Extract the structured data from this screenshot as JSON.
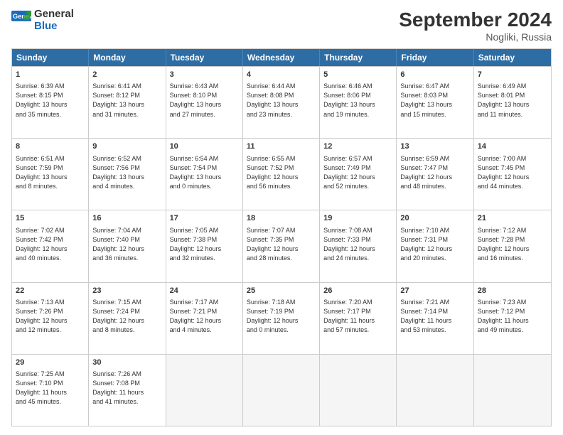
{
  "header": {
    "logo_general": "General",
    "logo_blue": "Blue",
    "title": "September 2024",
    "subtitle": "Nogliki, Russia"
  },
  "days_of_week": [
    "Sunday",
    "Monday",
    "Tuesday",
    "Wednesday",
    "Thursday",
    "Friday",
    "Saturday"
  ],
  "weeks": [
    [
      {
        "day": "1",
        "info": "Sunrise: 6:39 AM\nSunset: 8:15 PM\nDaylight: 13 hours\nand 35 minutes."
      },
      {
        "day": "2",
        "info": "Sunrise: 6:41 AM\nSunset: 8:12 PM\nDaylight: 13 hours\nand 31 minutes."
      },
      {
        "day": "3",
        "info": "Sunrise: 6:43 AM\nSunset: 8:10 PM\nDaylight: 13 hours\nand 27 minutes."
      },
      {
        "day": "4",
        "info": "Sunrise: 6:44 AM\nSunset: 8:08 PM\nDaylight: 13 hours\nand 23 minutes."
      },
      {
        "day": "5",
        "info": "Sunrise: 6:46 AM\nSunset: 8:06 PM\nDaylight: 13 hours\nand 19 minutes."
      },
      {
        "day": "6",
        "info": "Sunrise: 6:47 AM\nSunset: 8:03 PM\nDaylight: 13 hours\nand 15 minutes."
      },
      {
        "day": "7",
        "info": "Sunrise: 6:49 AM\nSunset: 8:01 PM\nDaylight: 13 hours\nand 11 minutes."
      }
    ],
    [
      {
        "day": "8",
        "info": "Sunrise: 6:51 AM\nSunset: 7:59 PM\nDaylight: 13 hours\nand 8 minutes."
      },
      {
        "day": "9",
        "info": "Sunrise: 6:52 AM\nSunset: 7:56 PM\nDaylight: 13 hours\nand 4 minutes."
      },
      {
        "day": "10",
        "info": "Sunrise: 6:54 AM\nSunset: 7:54 PM\nDaylight: 13 hours\nand 0 minutes."
      },
      {
        "day": "11",
        "info": "Sunrise: 6:55 AM\nSunset: 7:52 PM\nDaylight: 12 hours\nand 56 minutes."
      },
      {
        "day": "12",
        "info": "Sunrise: 6:57 AM\nSunset: 7:49 PM\nDaylight: 12 hours\nand 52 minutes."
      },
      {
        "day": "13",
        "info": "Sunrise: 6:59 AM\nSunset: 7:47 PM\nDaylight: 12 hours\nand 48 minutes."
      },
      {
        "day": "14",
        "info": "Sunrise: 7:00 AM\nSunset: 7:45 PM\nDaylight: 12 hours\nand 44 minutes."
      }
    ],
    [
      {
        "day": "15",
        "info": "Sunrise: 7:02 AM\nSunset: 7:42 PM\nDaylight: 12 hours\nand 40 minutes."
      },
      {
        "day": "16",
        "info": "Sunrise: 7:04 AM\nSunset: 7:40 PM\nDaylight: 12 hours\nand 36 minutes."
      },
      {
        "day": "17",
        "info": "Sunrise: 7:05 AM\nSunset: 7:38 PM\nDaylight: 12 hours\nand 32 minutes."
      },
      {
        "day": "18",
        "info": "Sunrise: 7:07 AM\nSunset: 7:35 PM\nDaylight: 12 hours\nand 28 minutes."
      },
      {
        "day": "19",
        "info": "Sunrise: 7:08 AM\nSunset: 7:33 PM\nDaylight: 12 hours\nand 24 minutes."
      },
      {
        "day": "20",
        "info": "Sunrise: 7:10 AM\nSunset: 7:31 PM\nDaylight: 12 hours\nand 20 minutes."
      },
      {
        "day": "21",
        "info": "Sunrise: 7:12 AM\nSunset: 7:28 PM\nDaylight: 12 hours\nand 16 minutes."
      }
    ],
    [
      {
        "day": "22",
        "info": "Sunrise: 7:13 AM\nSunset: 7:26 PM\nDaylight: 12 hours\nand 12 minutes."
      },
      {
        "day": "23",
        "info": "Sunrise: 7:15 AM\nSunset: 7:24 PM\nDaylight: 12 hours\nand 8 minutes."
      },
      {
        "day": "24",
        "info": "Sunrise: 7:17 AM\nSunset: 7:21 PM\nDaylight: 12 hours\nand 4 minutes."
      },
      {
        "day": "25",
        "info": "Sunrise: 7:18 AM\nSunset: 7:19 PM\nDaylight: 12 hours\nand 0 minutes."
      },
      {
        "day": "26",
        "info": "Sunrise: 7:20 AM\nSunset: 7:17 PM\nDaylight: 11 hours\nand 57 minutes."
      },
      {
        "day": "27",
        "info": "Sunrise: 7:21 AM\nSunset: 7:14 PM\nDaylight: 11 hours\nand 53 minutes."
      },
      {
        "day": "28",
        "info": "Sunrise: 7:23 AM\nSunset: 7:12 PM\nDaylight: 11 hours\nand 49 minutes."
      }
    ],
    [
      {
        "day": "29",
        "info": "Sunrise: 7:25 AM\nSunset: 7:10 PM\nDaylight: 11 hours\nand 45 minutes."
      },
      {
        "day": "30",
        "info": "Sunrise: 7:26 AM\nSunset: 7:08 PM\nDaylight: 11 hours\nand 41 minutes."
      },
      {
        "day": "",
        "info": ""
      },
      {
        "day": "",
        "info": ""
      },
      {
        "day": "",
        "info": ""
      },
      {
        "day": "",
        "info": ""
      },
      {
        "day": "",
        "info": ""
      }
    ]
  ]
}
